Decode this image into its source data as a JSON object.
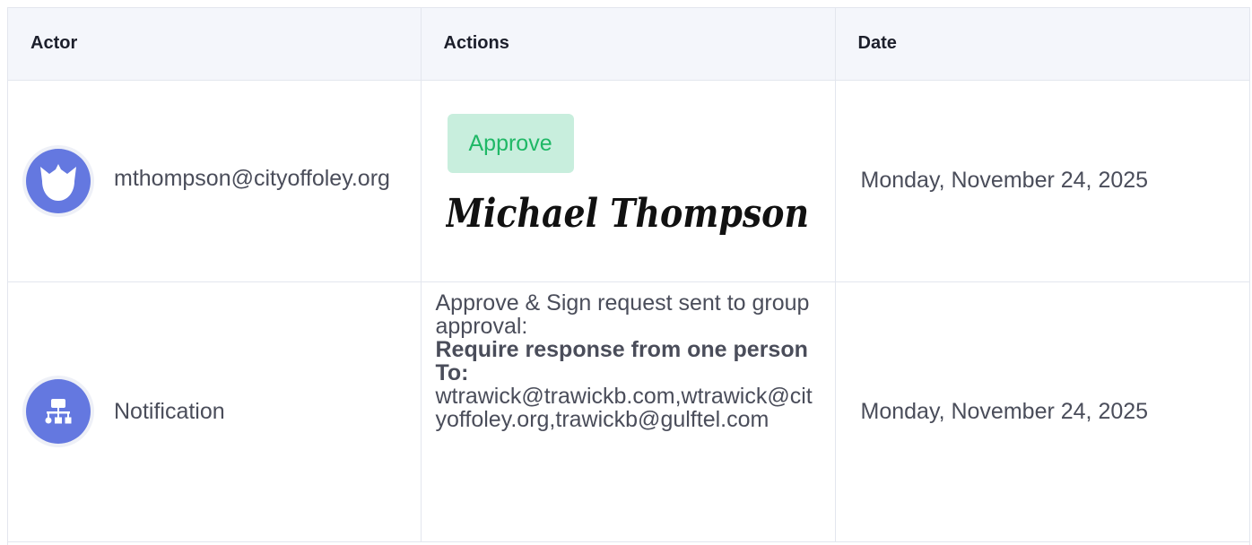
{
  "table": {
    "headers": {
      "actor": "Actor",
      "actions": "Actions",
      "date": "Date"
    },
    "rows": [
      {
        "actor": {
          "name": "mthompson@cityoffoley.org",
          "icon": "cat-face-icon"
        },
        "action": {
          "badge": "Approve",
          "signature": "Michael Thompson"
        },
        "date": "Monday, November 24, 2025"
      },
      {
        "actor": {
          "name": "Notification",
          "icon": "sitemap-icon"
        },
        "action": {
          "line1": "Approve & Sign request sent to group approval:",
          "line2": "Require response from one person",
          "line3": "To:",
          "recipients": "wtrawick@trawickb.com,wtrawick@cityoffoley.org,trawickb@gulftel.com"
        },
        "date": "Monday, November 24, 2025"
      }
    ]
  },
  "colors": {
    "avatar": "#6478e0",
    "badge_bg": "#c8eedd",
    "badge_text": "#1fb866",
    "header_bg": "#f4f6fb"
  }
}
